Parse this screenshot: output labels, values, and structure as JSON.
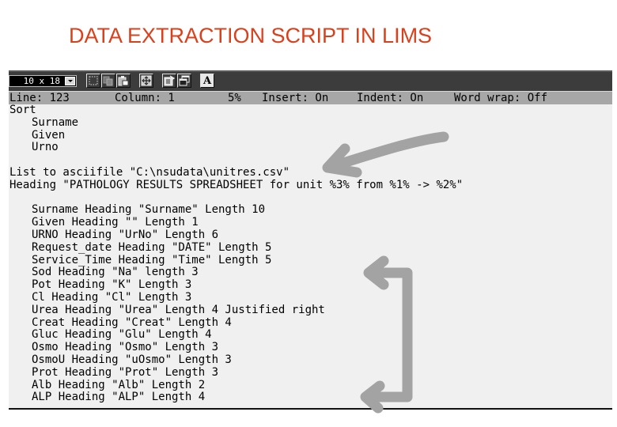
{
  "slide": {
    "title": "DATA EXTRACTION SCRIPT IN LIMS",
    "title_color": "#d9401c"
  },
  "toolbar": {
    "font_size_select": {
      "value": "10 x 18"
    },
    "buttons": [
      {
        "icon": "select-icon",
        "label": "Mark"
      },
      {
        "icon": "copy-icon",
        "label": "Copy"
      },
      {
        "icon": "paste-icon",
        "label": "Paste"
      },
      {
        "icon": "fullscreen-icon",
        "label": "Full screen"
      },
      {
        "icon": "properties-icon",
        "label": "Properties"
      },
      {
        "icon": "background-icon",
        "label": "Background"
      },
      {
        "icon": "font-icon",
        "label": "A"
      }
    ]
  },
  "statusbar": {
    "line": "Line: 123",
    "column": "Column: 1",
    "percent": "5%",
    "insert": "Insert: On",
    "indent": "Indent: On",
    "word_wrap": "Word wrap: Off"
  },
  "editor": {
    "lines": [
      {
        "text": "Sort",
        "indent": 0
      },
      {
        "text": "Surname",
        "indent": 1
      },
      {
        "text": "Given",
        "indent": 1
      },
      {
        "text": "Urno",
        "indent": 1
      },
      {
        "text": "",
        "indent": 0
      },
      {
        "text": "List to asciifile \"C:\\nsudata\\unitres.csv\"",
        "indent": 0
      },
      {
        "text": "Heading \"PATHOLOGY RESULTS SPREADSHEET for unit %3% from %1% -> %2%\"",
        "indent": 0
      },
      {
        "text": "",
        "indent": 0
      },
      {
        "text": "Surname Heading \"Surname\" Length 10",
        "indent": 1
      },
      {
        "text": "Given Heading \"\" Length 1",
        "indent": 1
      },
      {
        "text": "URNO Heading \"UrNo\" Length 6",
        "indent": 1
      },
      {
        "text": "Request_date Heading \"DATE\" Length 5",
        "indent": 1
      },
      {
        "text": "Service_Time Heading \"Time\" Length 5",
        "indent": 1
      },
      {
        "text": "Sod Heading \"Na\" length 3",
        "indent": 1
      },
      {
        "text": "Pot Heading \"K\" Length 3",
        "indent": 1
      },
      {
        "text": "Cl Heading \"Cl\" Length 3",
        "indent": 1
      },
      {
        "text": "Urea Heading \"Urea\" Length 4 Justified right",
        "indent": 1
      },
      {
        "text": "Creat Heading \"Creat\" Length 4",
        "indent": 1
      },
      {
        "text": "Gluc Heading \"Glu\" Length 4",
        "indent": 1
      },
      {
        "text": "Osmo Heading \"Osmo\" Length 3",
        "indent": 1
      },
      {
        "text": "OsmoU Heading \"uOsmo\" Length 3",
        "indent": 1
      },
      {
        "text": "Prot Heading \"Prot\" Length 3",
        "indent": 1
      },
      {
        "text": "Alb Heading \"Alb\" Length 2",
        "indent": 1
      },
      {
        "text": "ALP Heading \"ALP\" Length 4",
        "indent": 1
      }
    ]
  },
  "annotations": {
    "arrow_color": "#a3a3a3",
    "items": [
      {
        "name": "arrow-pointing-to-output-file",
        "kind": "arrow"
      },
      {
        "name": "bracket-arrow-column-definitions",
        "kind": "bracket-arrow"
      }
    ]
  }
}
